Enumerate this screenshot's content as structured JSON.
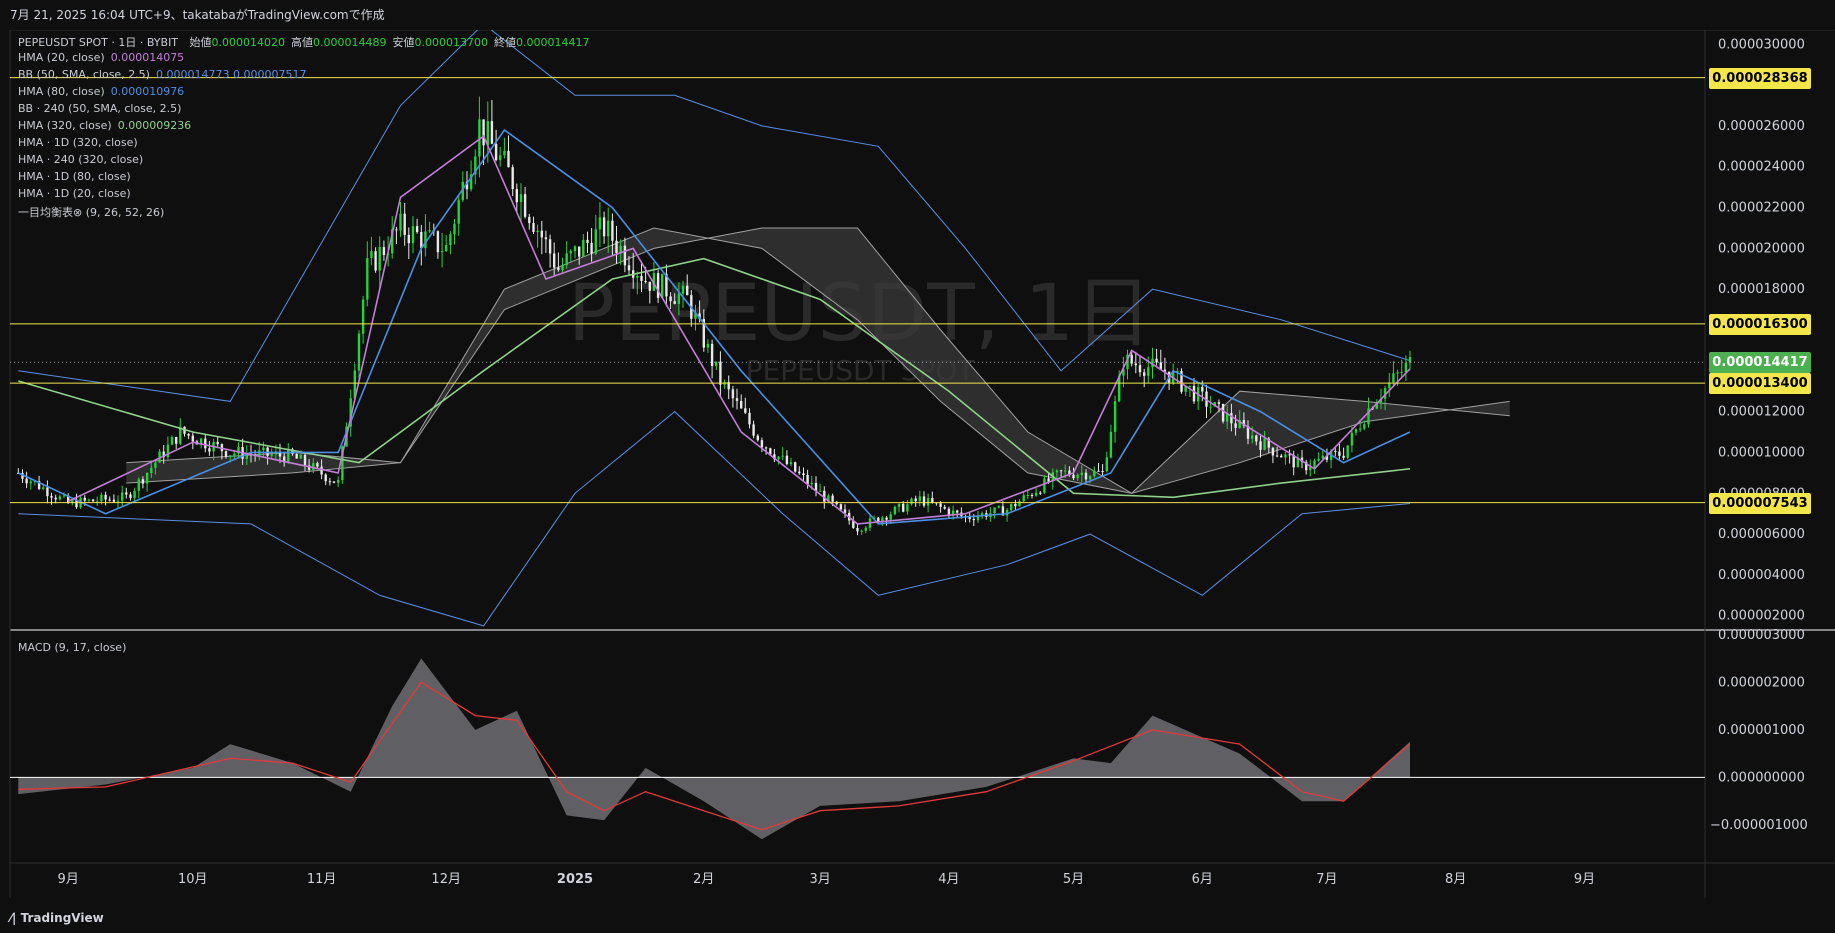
{
  "header": {
    "text": "7月 21, 2025 16:04 UTC+9、takatabaがTradingView.comで作成"
  },
  "footer": {
    "brand": "TradingView"
  },
  "watermark": {
    "main": "PEPEUSDT, 1日",
    "sub": "PEPEUSDT SPOT"
  },
  "legend": {
    "symbol_line": "PEPEUSDT SPOT · 1日 · BYBIT",
    "ohlc": [
      {
        "label": "始値",
        "value": "0.000014020"
      },
      {
        "label": "高値",
        "value": "0.000014489"
      },
      {
        "label": "安値",
        "value": "0.000013700"
      },
      {
        "label": "終値",
        "value": "0.000014417"
      }
    ],
    "indicators": [
      {
        "name": "HMA (20, close)",
        "value": "0.000014075",
        "color": "#c27ed6"
      },
      {
        "name": "BB (50, SMA, close, 2.5)",
        "value": "0.000014773  0.000007517",
        "color": "#5b8fe0"
      },
      {
        "name": "HMA (80, close)",
        "value": "0.000010976",
        "color": "#4a90e2"
      },
      {
        "name": "BB · 240 (50, SMA, close, 2.5)",
        "value": "",
        "color": ""
      },
      {
        "name": "HMA (320, close)",
        "value": "0.000009236",
        "color": "#8fd18a"
      },
      {
        "name": "HMA · 1D (320, close)",
        "value": "",
        "color": ""
      },
      {
        "name": "HMA · 240 (320, close)",
        "value": "",
        "color": ""
      },
      {
        "name": "HMA · 1D (80, close)",
        "value": "",
        "color": ""
      },
      {
        "name": "HMA · 1D (20, close)",
        "value": "",
        "color": ""
      },
      {
        "name": "一目均衡表⊗ (9, 26, 52, 26)",
        "value": "",
        "color": ""
      }
    ]
  },
  "macd_legend": "MACD (9, 17, close)",
  "price_tags": [
    {
      "value": "0.000028368",
      "price": 2.8368e-05,
      "bg": "#f2e64a",
      "fg": "#000000"
    },
    {
      "value": "0.000016300",
      "price": 1.63e-05,
      "bg": "#f2e64a",
      "fg": "#000000"
    },
    {
      "value": "0.000014417",
      "price": 1.4417e-05,
      "bg": "#4caf50",
      "fg": "#ffffff"
    },
    {
      "value": "0.000013400",
      "price": 1.34e-05,
      "bg": "#f2e64a",
      "fg": "#000000"
    },
    {
      "value": "0.000007543",
      "price": 7.543e-06,
      "bg": "#f2e64a",
      "fg": "#000000"
    }
  ],
  "chart_data": {
    "type": "line",
    "price_axis": {
      "ticks": [
        "0.000030000",
        "0.000028000",
        "0.000026000",
        "0.000024000",
        "0.000022000",
        "0.000020000",
        "0.000018000",
        "0.000016000",
        "0.000014000",
        "0.000012000",
        "0.000010000",
        "0.000008000",
        "0.000006000",
        "0.000004000",
        "0.000002000"
      ],
      "range": [
        1.3e-06,
        3.07e-05
      ]
    },
    "macd_axis": {
      "ticks": [
        "0.000003000",
        "0.000002000",
        "0.000001000",
        "0.000000000",
        "−0.000001000"
      ],
      "range": [
        -1.8e-06,
        3.1e-06
      ]
    },
    "time_axis": {
      "labels": [
        "9月",
        "10月",
        "11月",
        "12月",
        "2025",
        "2月",
        "3月",
        "4月",
        "5月",
        "6月",
        "7月",
        "8月",
        "9月"
      ],
      "bold": [
        false,
        false,
        false,
        false,
        true,
        false,
        false,
        false,
        false,
        false,
        false,
        false,
        false
      ]
    },
    "horizontal_levels": [
      2.8368e-05,
      1.63e-05,
      1.34e-05,
      7.543e-06
    ],
    "last_price": 1.4417e-05,
    "price_series": [
      [
        "2024-08-20",
        9e-06
      ],
      [
        "2024-09-01",
        7.5e-06
      ],
      [
        "2024-09-15",
        7.8e-06
      ],
      [
        "2024-09-28",
        1.1e-05
      ],
      [
        "2024-10-10",
        1e-05
      ],
      [
        "2024-10-25",
        9.8e-06
      ],
      [
        "2024-11-05",
        8.5e-06
      ],
      [
        "2024-11-12",
        1.9e-05
      ],
      [
        "2024-11-20",
        2.1e-05
      ],
      [
        "2024-12-01",
        2e-05
      ],
      [
        "2024-12-09",
        2.6e-05
      ],
      [
        "2024-12-18",
        2.3e-05
      ],
      [
        "2024-12-28",
        1.9e-05
      ],
      [
        "2025-01-08",
        2.1e-05
      ],
      [
        "2025-01-18",
        1.85e-05
      ],
      [
        "2025-01-28",
        1.75e-05
      ],
      [
        "2025-02-05",
        1.35e-05
      ],
      [
        "2025-02-15",
        1.05e-05
      ],
      [
        "2025-03-01",
        8e-06
      ],
      [
        "2025-03-10",
        6.3e-06
      ],
      [
        "2025-03-25",
        7.7e-06
      ],
      [
        "2025-04-05",
        6.8e-06
      ],
      [
        "2025-04-15",
        7.2e-06
      ],
      [
        "2025-04-28",
        9e-06
      ],
      [
        "2025-05-08",
        9e-06
      ],
      [
        "2025-05-13",
        1.45e-05
      ],
      [
        "2025-05-23",
        1.4e-05
      ],
      [
        "2025-06-05",
        1.2e-05
      ],
      [
        "2025-06-15",
        1.05e-05
      ],
      [
        "2025-06-25",
        9.3e-06
      ],
      [
        "2025-07-05",
        1e-05
      ],
      [
        "2025-07-12",
        1.25e-05
      ],
      [
        "2025-07-21",
        1.44e-05
      ]
    ],
    "series": [
      {
        "name": "HMA (20, close)",
        "color": "#c27ed6",
        "values": [
          [
            "2024-09-01",
            7.6e-06
          ],
          [
            "2024-10-01",
            1.05e-05
          ],
          [
            "2024-11-05",
            9e-06
          ],
          [
            "2024-11-20",
            2.25e-05
          ],
          [
            "2024-12-10",
            2.55e-05
          ],
          [
            "2024-12-25",
            1.85e-05
          ],
          [
            "2025-01-15",
            2e-05
          ],
          [
            "2025-02-10",
            1.1e-05
          ],
          [
            "2025-03-10",
            6.5e-06
          ],
          [
            "2025-04-05",
            7e-06
          ],
          [
            "2025-05-01",
            9e-06
          ],
          [
            "2025-05-15",
            1.5e-05
          ],
          [
            "2025-06-10",
            1.15e-05
          ],
          [
            "2025-06-28",
            9.2e-06
          ],
          [
            "2025-07-21",
            1.41e-05
          ]
        ]
      },
      {
        "name": "HMA (80, close)",
        "color": "#4a90e2",
        "values": [
          [
            "2024-08-20",
            9e-06
          ],
          [
            "2024-09-10",
            7e-06
          ],
          [
            "2024-10-15",
            1e-05
          ],
          [
            "2024-11-05",
            1e-05
          ],
          [
            "2024-11-25",
            2e-05
          ],
          [
            "2024-12-15",
            2.58e-05
          ],
          [
            "2025-01-10",
            2.2e-05
          ],
          [
            "2025-02-10",
            1.4e-05
          ],
          [
            "2025-03-15",
            6.5e-06
          ],
          [
            "2025-04-15",
            7e-06
          ],
          [
            "2025-05-10",
            9e-06
          ],
          [
            "2025-05-25",
            1.4e-05
          ],
          [
            "2025-06-15",
            1.2e-05
          ],
          [
            "2025-07-05",
            9.5e-06
          ],
          [
            "2025-07-21",
            1.1e-05
          ]
        ]
      },
      {
        "name": "HMA (320, close)",
        "color": "#8fd18a",
        "values": [
          [
            "2024-08-20",
            1.35e-05
          ],
          [
            "2024-10-01",
            1.1e-05
          ],
          [
            "2024-11-10",
            9.5e-06
          ],
          [
            "2024-12-10",
            1.4e-05
          ],
          [
            "2025-01-10",
            1.85e-05
          ],
          [
            "2025-02-01",
            1.95e-05
          ],
          [
            "2025-03-01",
            1.75e-05
          ],
          [
            "2025-04-01",
            1.3e-05
          ],
          [
            "2025-05-01",
            8e-06
          ],
          [
            "2025-05-25",
            7.8e-06
          ],
          [
            "2025-06-20",
            8.5e-06
          ],
          [
            "2025-07-21",
            9.2e-06
          ]
        ]
      },
      {
        "name": "BB upper",
        "color": "#5b8fe0",
        "values": [
          [
            "2024-08-20",
            1.4e-05
          ],
          [
            "2024-10-10",
            1.25e-05
          ],
          [
            "2024-11-20",
            2.7e-05
          ],
          [
            "2024-12-10",
            3.1e-05
          ],
          [
            "2025-01-01",
            2.75e-05
          ],
          [
            "2025-01-25",
            2.75e-05
          ],
          [
            "2025-02-15",
            2.6e-05
          ],
          [
            "2025-03-15",
            2.5e-05
          ],
          [
            "2025-04-05",
            2e-05
          ],
          [
            "2025-04-28",
            1.4e-05
          ],
          [
            "2025-05-20",
            1.8e-05
          ],
          [
            "2025-06-20",
            1.65e-05
          ],
          [
            "2025-07-21",
            1.45e-05
          ]
        ]
      },
      {
        "name": "BB lower",
        "color": "#5b8fe0",
        "values": [
          [
            "2024-08-20",
            7e-06
          ],
          [
            "2024-10-15",
            6.5e-06
          ],
          [
            "2024-11-15",
            3e-06
          ],
          [
            "2024-12-10",
            1.5e-06
          ],
          [
            "2025-01-01",
            8e-06
          ],
          [
            "2025-01-25",
            1.2e-05
          ],
          [
            "2025-02-20",
            7e-06
          ],
          [
            "2025-03-15",
            3e-06
          ],
          [
            "2025-04-15",
            4.5e-06
          ],
          [
            "2025-05-05",
            6e-06
          ],
          [
            "2025-06-01",
            3e-06
          ],
          [
            "2025-06-25",
            7e-06
          ],
          [
            "2025-07-21",
            7.5e-06
          ]
        ]
      },
      {
        "name": "Ichimoku span A",
        "color": "#9a9a9a",
        "values": [
          [
            "2024-09-15",
            9.5e-06
          ],
          [
            "2024-10-25",
            1e-05
          ],
          [
            "2024-11-20",
            9.5e-06
          ],
          [
            "2024-12-15",
            1.7e-05
          ],
          [
            "2025-01-20",
            2e-05
          ],
          [
            "2025-02-15",
            2.1e-05
          ],
          [
            "2025-03-10",
            2.1e-05
          ],
          [
            "2025-03-30",
            1.6e-05
          ],
          [
            "2025-04-20",
            1.1e-05
          ],
          [
            "2025-05-15",
            8e-06
          ],
          [
            "2025-06-10",
            9.5e-06
          ],
          [
            "2025-07-10",
            1.15e-05
          ],
          [
            "2025-08-14",
            1.25e-05
          ]
        ]
      },
      {
        "name": "Ichimoku span B",
        "color": "#9a9a9a",
        "values": [
          [
            "2024-09-15",
            8.5e-06
          ],
          [
            "2024-10-25",
            9e-06
          ],
          [
            "2024-11-20",
            9.5e-06
          ],
          [
            "2024-12-15",
            1.8e-05
          ],
          [
            "2025-01-20",
            2.1e-05
          ],
          [
            "2025-02-15",
            2e-05
          ],
          [
            "2025-03-10",
            1.65e-05
          ],
          [
            "2025-03-30",
            1.25e-05
          ],
          [
            "2025-04-20",
            9e-06
          ],
          [
            "2025-05-15",
            8e-06
          ],
          [
            "2025-06-10",
            1.3e-05
          ],
          [
            "2025-07-10",
            1.25e-05
          ],
          [
            "2025-08-14",
            1.18e-05
          ]
        ]
      }
    ],
    "macd": [
      [
        "2024-08-20",
        -3.5e-07
      ],
      [
        "2024-09-10",
        -1.5e-07
      ],
      [
        "2024-10-01",
        2e-07
      ],
      [
        "2024-10-10",
        7e-07
      ],
      [
        "2024-10-25",
        3e-07
      ],
      [
        "2024-11-08",
        -3e-07
      ],
      [
        "2024-11-18",
        1.5e-06
      ],
      [
        "2024-11-25",
        2.5e-06
      ],
      [
        "2024-12-08",
        1e-06
      ],
      [
        "2024-12-18",
        1.4e-06
      ],
      [
        "2024-12-30",
        -8e-07
      ],
      [
        "2025-01-08",
        -9e-07
      ],
      [
        "2025-01-18",
        2e-07
      ],
      [
        "2025-02-01",
        -5e-07
      ],
      [
        "2025-02-15",
        -1.3e-06
      ],
      [
        "2025-03-01",
        -6e-07
      ],
      [
        "2025-03-20",
        -5e-07
      ],
      [
        "2025-04-10",
        -2e-07
      ],
      [
        "2025-05-01",
        4e-07
      ],
      [
        "2025-05-10",
        3e-07
      ],
      [
        "2025-05-20",
        1.3e-06
      ],
      [
        "2025-06-10",
        5e-07
      ],
      [
        "2025-06-25",
        -5e-07
      ],
      [
        "2025-07-05",
        -5e-07
      ],
      [
        "2025-07-21",
        7.5e-07
      ]
    ],
    "macd_signal": [
      [
        "2024-08-20",
        -2.5e-07
      ],
      [
        "2024-09-10",
        -2e-07
      ],
      [
        "2024-10-10",
        4e-07
      ],
      [
        "2024-10-25",
        3e-07
      ],
      [
        "2024-11-08",
        -1e-07
      ],
      [
        "2024-11-25",
        2e-06
      ],
      [
        "2024-12-08",
        1.3e-06
      ],
      [
        "2024-12-18",
        1.2e-06
      ],
      [
        "2024-12-30",
        -3e-07
      ],
      [
        "2025-01-08",
        -7e-07
      ],
      [
        "2025-01-18",
        -3e-07
      ],
      [
        "2025-02-15",
        -1.1e-06
      ],
      [
        "2025-03-01",
        -7e-07
      ],
      [
        "2025-03-20",
        -6e-07
      ],
      [
        "2025-04-10",
        -3e-07
      ],
      [
        "2025-05-01",
        3.5e-07
      ],
      [
        "2025-05-20",
        1e-06
      ],
      [
        "2025-06-10",
        7e-07
      ],
      [
        "2025-06-25",
        -3e-07
      ],
      [
        "2025-07-05",
        -5e-07
      ],
      [
        "2025-07-21",
        7e-07
      ]
    ]
  }
}
